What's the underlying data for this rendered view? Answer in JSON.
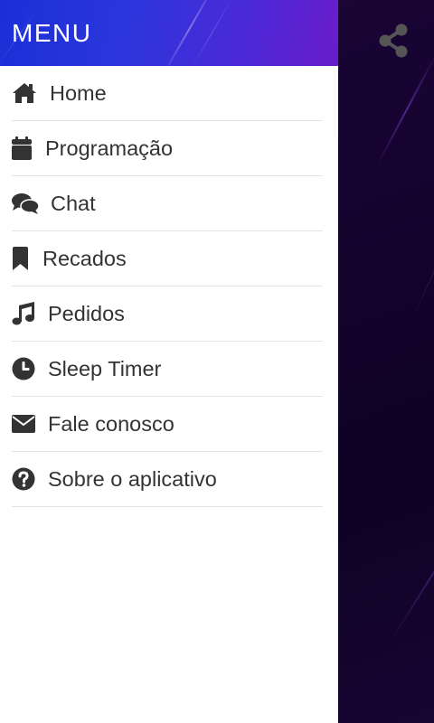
{
  "drawer": {
    "title": "MENU",
    "items": [
      {
        "label": "Home",
        "icon": "home-icon"
      },
      {
        "label": "Programação",
        "icon": "calendar-icon"
      },
      {
        "label": "Chat",
        "icon": "chat-bubbles-icon"
      },
      {
        "label": "Recados",
        "icon": "bookmark-icon"
      },
      {
        "label": "Pedidos",
        "icon": "music-note-icon"
      },
      {
        "label": "Sleep Timer",
        "icon": "clock-icon"
      },
      {
        "label": "Fale conosco",
        "icon": "envelope-icon"
      },
      {
        "label": "Sobre o aplicativo",
        "icon": "question-circle-icon"
      }
    ]
  },
  "background": {
    "share_icon": "share-icon"
  },
  "colors": {
    "header_gradient_start": "#1b2fd6",
    "header_gradient_end": "#6a1ccb",
    "menu_text": "#333333",
    "divider": "#e3e3e3",
    "background_dark": "#160330",
    "share_icon": "#555555"
  }
}
